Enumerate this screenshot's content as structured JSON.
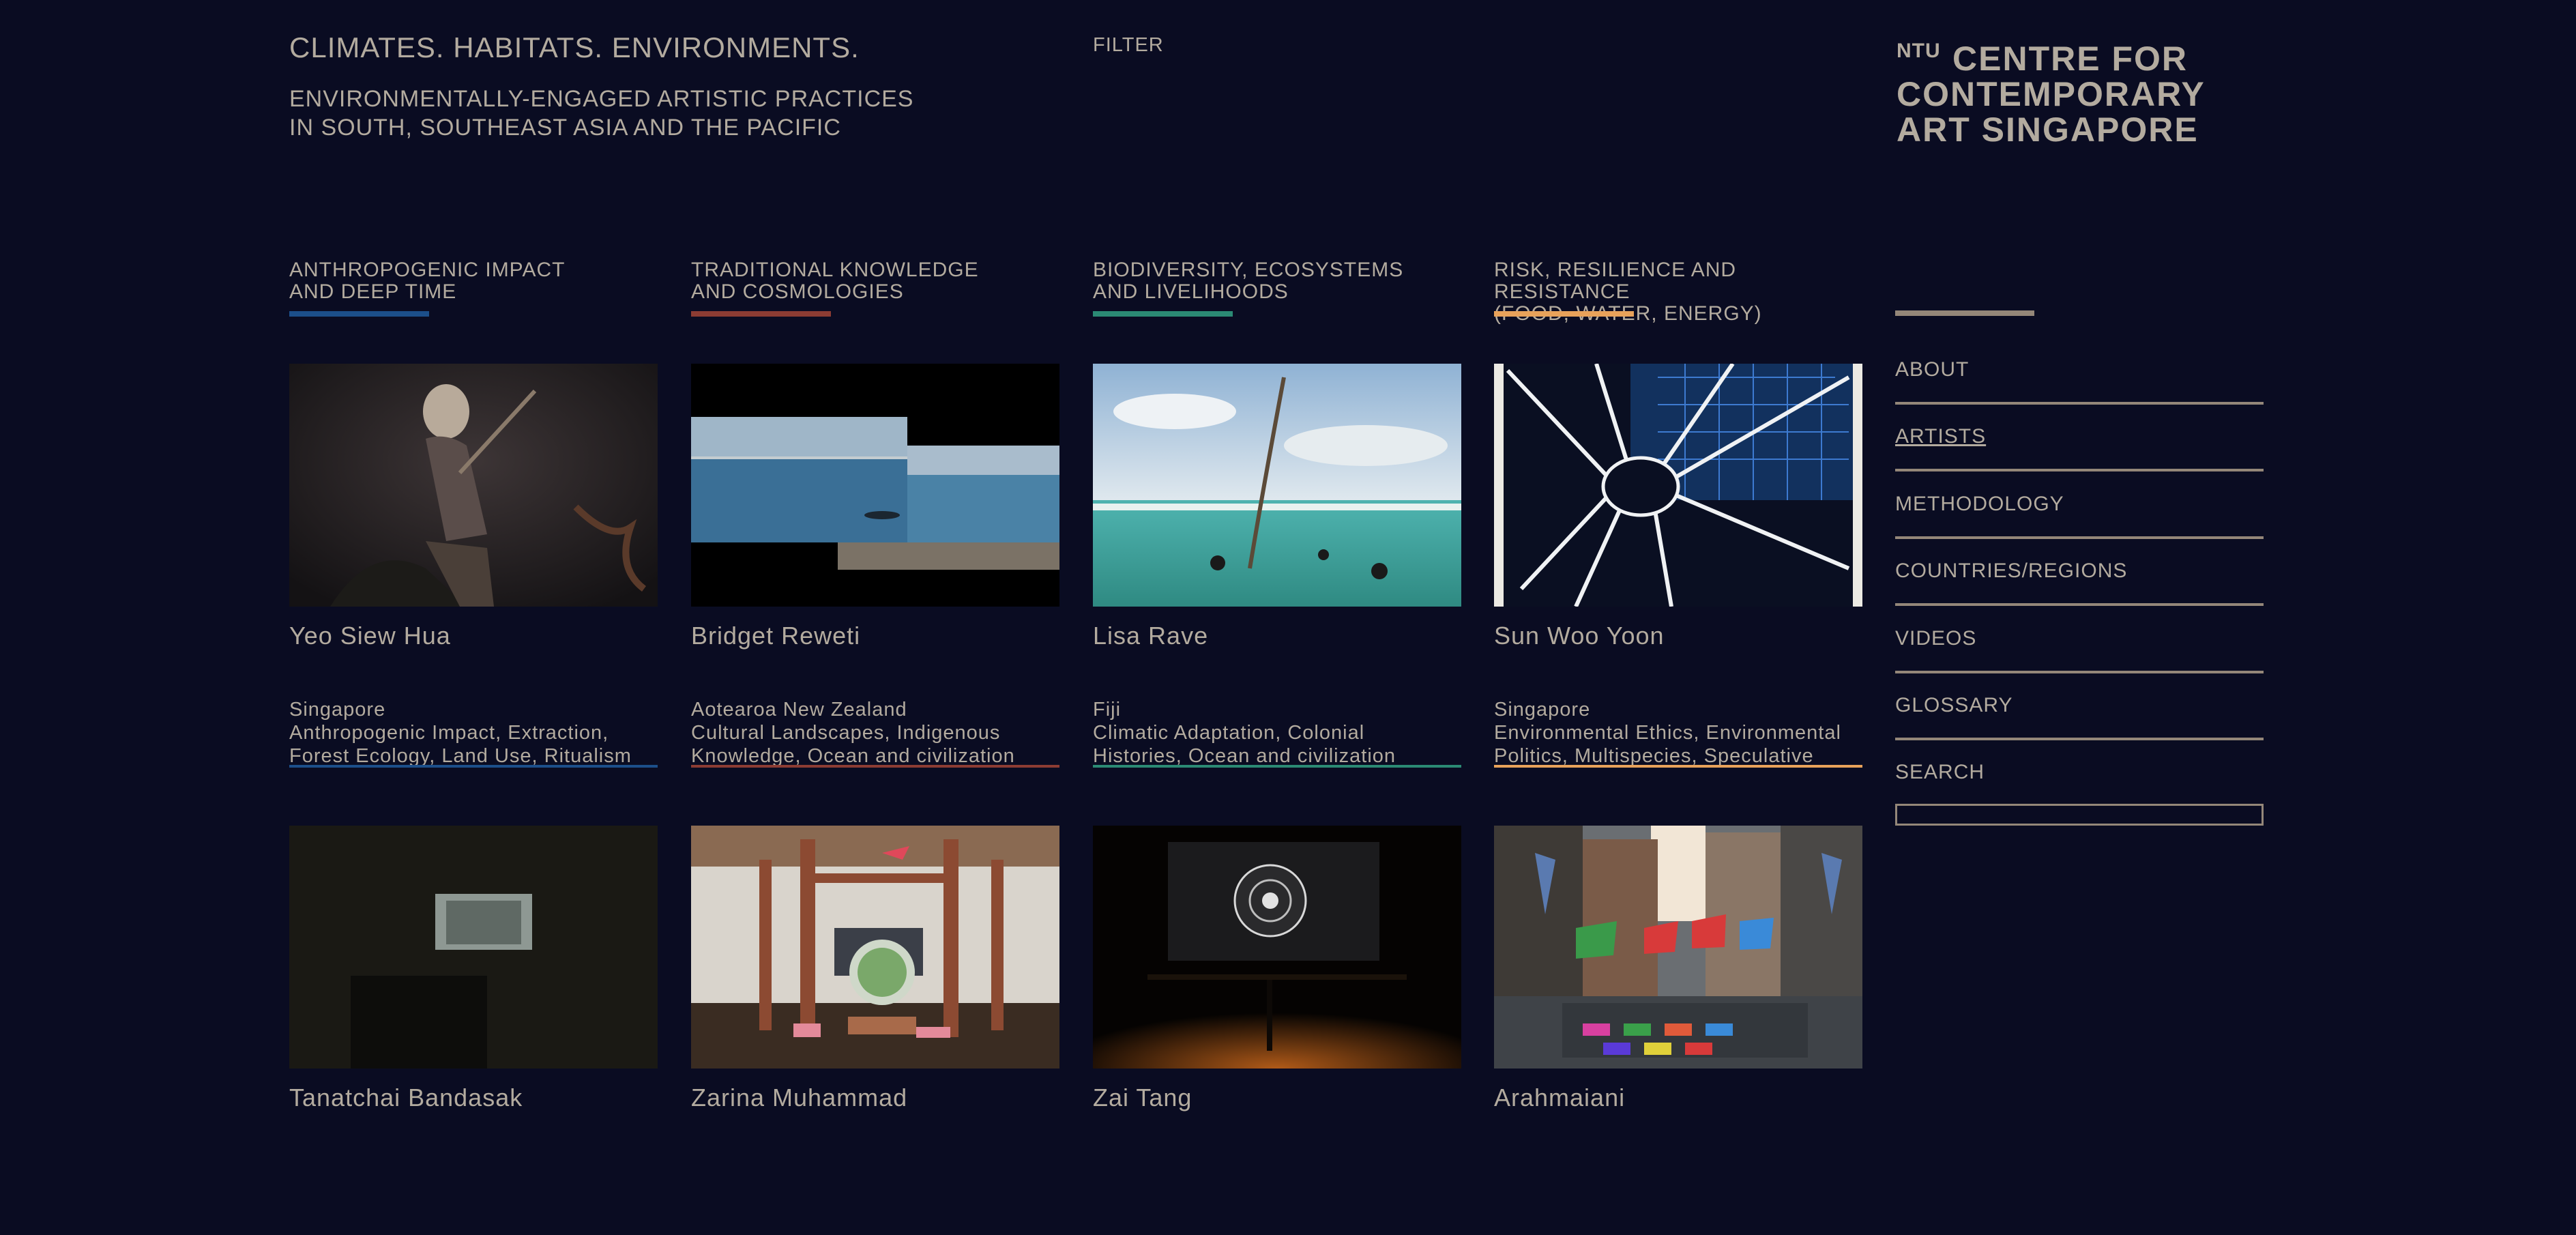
{
  "header": {
    "title": "CLIMATES. HABITATS. ENVIRONMENTS.",
    "subtitle_line1": "ENVIRONMENTALLY-ENGAGED ARTISTIC PRACTICES",
    "subtitle_line2": "IN SOUTH, SOUTHEAST ASIA AND THE PACIFIC",
    "filter_label": "FILTER"
  },
  "logo": {
    "ntu": "NTU",
    "line1": "CENTRE FOR",
    "line2": "CONTEMPORARY",
    "line3": "ART SINGAPORE"
  },
  "categories": [
    {
      "line1": "ANTHROPOGENIC IMPACT",
      "line2": "AND DEEP TIME",
      "color": "#1c4f8a"
    },
    {
      "line1": "TRADITIONAL KNOWLEDGE",
      "line2": "AND COSMOLOGIES",
      "color": "#8c3c33"
    },
    {
      "line1": "BIODIVERSITY, ECOSYSTEMS",
      "line2": "AND LIVELIHOODS",
      "color": "#2b8a74"
    },
    {
      "line1": "RISK, RESILIENCE AND RESISTANCE",
      "line2": "(FOOD, WATER, ENERGY)",
      "color": "#e8a25a"
    }
  ],
  "artists": [
    {
      "name": "Yeo Siew Hua",
      "country": "Singapore",
      "tags1": "Anthropogenic Impact, Extraction,",
      "tags2": "Forest Ecology, Land Use, Ritualism",
      "color": "#1c4f8a"
    },
    {
      "name": "Bridget Reweti",
      "country": "Aotearoa New Zealand",
      "tags1": "Cultural Landscapes, Indigenous",
      "tags2": "Knowledge, Ocean and civilization",
      "color": "#8c3c33"
    },
    {
      "name": "Lisa Rave",
      "country": "Fiji",
      "tags1": "Climatic Adaptation, Colonial",
      "tags2": "Histories, Ocean and civilization",
      "color": "#2b8a74"
    },
    {
      "name": "Sun Woo Yoon",
      "country": "Singapore",
      "tags1": "Environmental Ethics, Environmental",
      "tags2": "Politics, Multispecies, Speculative",
      "color": "#e8a25a"
    },
    {
      "name": "Tanatchai Bandasak"
    },
    {
      "name": "Zarina Muhammad"
    },
    {
      "name": "Zai Tang"
    },
    {
      "name": "Arahmaiani"
    }
  ],
  "nav": {
    "items": [
      {
        "label": "ABOUT"
      },
      {
        "label": "ARTISTS"
      },
      {
        "label": "METHODOLOGY"
      },
      {
        "label": "COUNTRIES/REGIONS"
      },
      {
        "label": "VIDEOS"
      },
      {
        "label": "GLOSSARY"
      },
      {
        "label": "SEARCH"
      }
    ]
  }
}
